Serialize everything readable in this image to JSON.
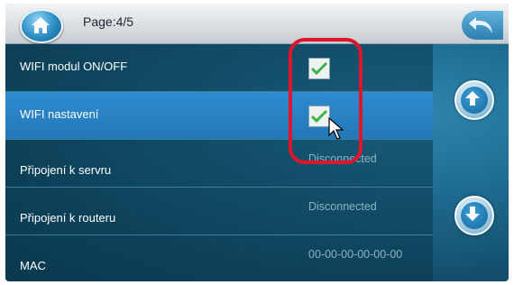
{
  "header": {
    "page_label": "Page:4/5",
    "home_icon": "home-icon",
    "back_icon": "back-arrow-icon"
  },
  "rows": [
    {
      "label": "WIFI modul ON/OFF",
      "type": "checkbox",
      "checked": true
    },
    {
      "label": "WIFI nastavení",
      "type": "checkbox",
      "checked": true
    },
    {
      "label": "Připojení k servru",
      "type": "value",
      "value": "Disconnected"
    },
    {
      "label": "Připojení k routeru",
      "type": "value",
      "value": "Disconnected"
    },
    {
      "label": "MAC",
      "type": "value",
      "value": "00-00-00-00-00-00"
    }
  ],
  "side": {
    "up_icon": "arrow-up-icon",
    "down_icon": "arrow-down-icon"
  },
  "colors": {
    "selected_row": "#2f8ccf",
    "highlight": "#e0142b",
    "check": "#3cb34a"
  }
}
